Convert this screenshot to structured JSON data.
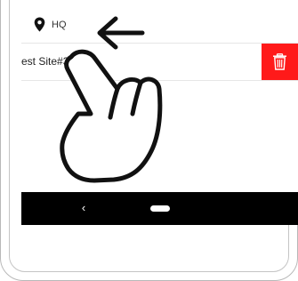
{
  "location": {
    "icon": "map-pin-icon",
    "label": "HQ"
  },
  "site_row": {
    "name": "est Site#3",
    "delete_icon": "trash-icon",
    "delete_color": "#ff1a1a"
  },
  "nav_bar": {
    "back_label": "‹",
    "back_icon": "back-chevron-icon",
    "home_icon": "home-pill-icon"
  },
  "gesture": {
    "hand_icon": "pointing-hand-icon",
    "arrow_icon": "left-arrow-icon",
    "direction": "swipe-left"
  }
}
